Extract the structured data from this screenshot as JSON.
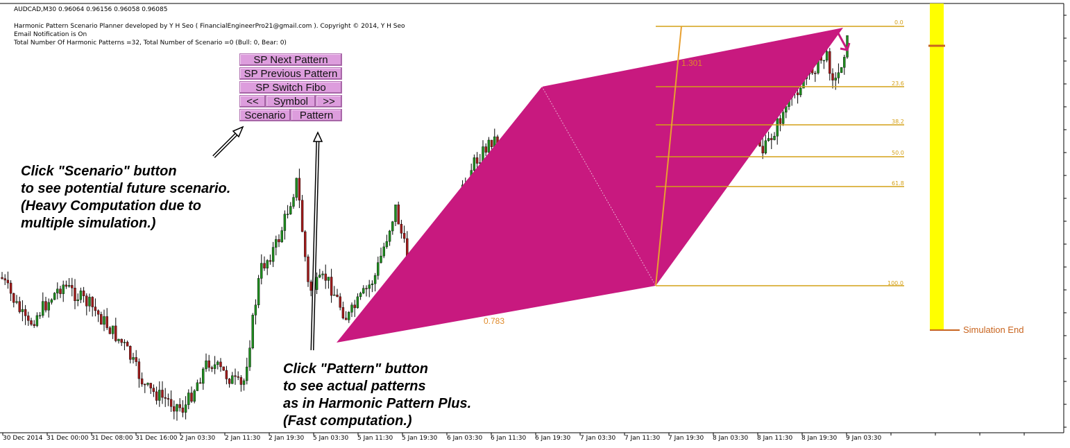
{
  "chart_header": {
    "symbol_line": "AUDCAD,M30  0.96064 0.96156 0.96058 0.96085",
    "info_line_1": "Harmonic Pattern Scenario Planner developed by Y H Seo ( FinancialEngineerPro21@gmail.com ). Copyright © 2014, Y H Seo",
    "info_line_2": "Email Notification is On",
    "info_line_3": "Total Number Of Harmonic Patterns =32, Total Number of Scenario =0 (Bull: 0, Bear: 0)"
  },
  "panel": {
    "next_pattern": "SP Next Pattern",
    "previous_pattern": "SP Previous Pattern",
    "switch_fibo": "SP Switch Fibo",
    "prev_symbol": "<<",
    "symbol": "Symbol",
    "next_symbol": ">>",
    "scenario": "Scenario",
    "pattern": "Pattern"
  },
  "annotations": {
    "scenario_note": "Click \"Scenario\" button\nto see potential future scenario.\n(Heavy Computation due to\nmultiple simulation.)",
    "pattern_note": "Click \"Pattern\" button\nto see actual patterns\nas in Harmonic Pattern Plus.\n(Fast computation.)"
  },
  "pattern_ratios": {
    "xb": "0.783",
    "bd": "1.301"
  },
  "fibo_levels": [
    "0.0",
    "23.6",
    "38.2",
    "50.0",
    "61.8",
    "100.0"
  ],
  "simulation_label": "Simulation End",
  "x_axis_ticks": [
    "30 Dec 2014",
    "31 Dec 00:00",
    "31 Dec 08:00",
    "31 Dec 16:00",
    "2 Jan 03:30",
    "2 Jan 11:30",
    "2 Jan 19:30",
    "5 Jan 03:30",
    "5 Jan 11:30",
    "5 Jan 19:30",
    "6 Jan 03:30",
    "6 Jan 11:30",
    "6 Jan 19:30",
    "7 Jan 03:30",
    "7 Jan 11:30",
    "7 Jan 19:30",
    "8 Jan 03:30",
    "8 Jan 11:30",
    "8 Jan 19:30",
    "9 Jan 03:30"
  ],
  "colors": {
    "pattern_fill": "#c8197f",
    "fibo_line": "#d4a017",
    "bull_candle": "#1e8c1e",
    "bear_candle": "#a01a1a",
    "simulation_bar": "#ffff00",
    "button_bg": "#dd9ddd"
  }
}
